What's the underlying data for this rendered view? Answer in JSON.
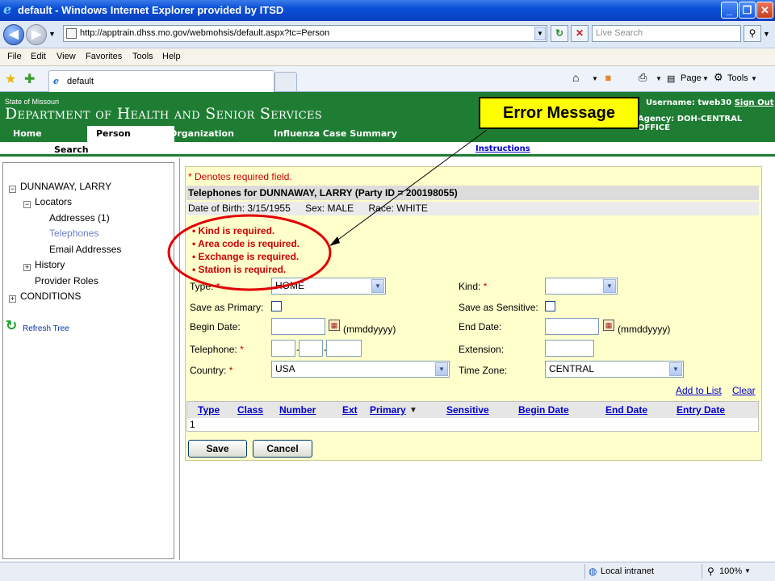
{
  "window": {
    "title": "default - Windows Internet Explorer provided by ITSD",
    "min": "_",
    "max": "❐",
    "close": "✕"
  },
  "browser": {
    "url": "http://apptrain.dhss.mo.gov/webmohsis/default.aspx?tc=Person",
    "search_placeholder": "Live Search",
    "tab_title": "default",
    "menu": [
      "File",
      "Edit",
      "View",
      "Favorites",
      "Tools",
      "Help"
    ],
    "toolbar": {
      "page": "Page",
      "tools": "Tools"
    },
    "status": {
      "zone": "Local intranet",
      "zoom": "100%"
    }
  },
  "site": {
    "state": "State of Missouri",
    "department": "Department of Health and Senior Services",
    "nav": [
      "Home",
      "Person",
      "Organization",
      "Influenza Case Summary"
    ],
    "username_label": "Username:",
    "username": "tweb30",
    "signout": "Sign Out",
    "agency": "Agency: DOH-CENTRAL OFFICE",
    "search": "Search",
    "instructions": "Instructions"
  },
  "callout": {
    "label": "Error Message"
  },
  "tree": {
    "root": "DUNNAWAY, LARRY",
    "locators": "Locators",
    "addresses": "Addresses (1)",
    "telephones": "Telephones",
    "email": "Email Addresses",
    "history": "History",
    "provider_roles": "Provider Roles",
    "conditions": "CONDITIONS",
    "refresh": "Refresh Tree"
  },
  "form": {
    "required_note": "* Denotes required field.",
    "heading": "Telephones for DUNNAWAY, LARRY (Party ID = 200198055)",
    "dob_label": "Date of Birth:",
    "dob": "3/15/1955",
    "sex_label": "Sex:",
    "sex": "MALE",
    "race_label": "Race:",
    "race": "WHITE",
    "errors": [
      "Kind is required.",
      "Area code is required.",
      "Exchange is required.",
      "Station is required."
    ],
    "type_label": "Type:",
    "type_value": "HOME",
    "kind_label": "Kind:",
    "kind_value": "",
    "primary_label": "Save as Primary:",
    "sensitive_label": "Save as Sensitive:",
    "begin_label": "Begin Date:",
    "end_label": "End Date:",
    "date_hint": "(mmddyyyy)",
    "telephone_label": "Telephone:",
    "extension_label": "Extension:",
    "country_label": "Country:",
    "country_value": "USA",
    "timezone_label": "Time Zone:",
    "timezone_value": "CENTRAL",
    "add_to_list": "Add to List",
    "clear": "Clear",
    "star": "*"
  },
  "grid": {
    "columns": [
      "Type",
      "Class",
      "Number",
      "Ext",
      "Primary",
      "Sensitive",
      "Begin Date",
      "End Date",
      "Entry Date"
    ],
    "sort_marker": "▼",
    "row1": "1"
  },
  "buttons": {
    "save": "Save",
    "cancel": "Cancel"
  },
  "colors": {
    "header_green": "#1e7d32",
    "error_red": "#cc0000",
    "callout_yellow": "#ffff00",
    "panel_yellow": "#ffffcc"
  }
}
